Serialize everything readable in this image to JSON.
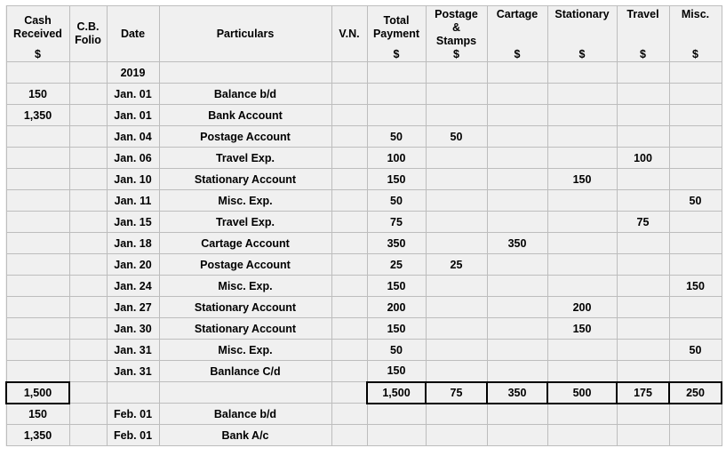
{
  "document": {
    "kind": "petty-cash-book",
    "year_label": "2019",
    "background_color": "#f0f0f0",
    "gridline_color": "#bdbdbd",
    "rule_color": "#000000"
  },
  "columns": [
    {
      "key": "cash",
      "lines": [
        "Cash",
        "Received"
      ],
      "unit": "$",
      "align": "middle"
    },
    {
      "key": "folio",
      "lines": [
        "C.B.",
        "Folio"
      ],
      "unit": "",
      "align": "middle"
    },
    {
      "key": "date",
      "lines": [
        "Date"
      ],
      "unit": "",
      "align": "middle"
    },
    {
      "key": "part",
      "lines": [
        "Particulars"
      ],
      "unit": "",
      "align": "middle"
    },
    {
      "key": "vn",
      "lines": [
        "V.N."
      ],
      "unit": "",
      "align": "middle"
    },
    {
      "key": "total",
      "lines": [
        "Total",
        "Payment"
      ],
      "unit": "$",
      "align": "middle"
    },
    {
      "key": "postage",
      "lines": [
        "Postage",
        "&",
        "Stamps"
      ],
      "unit": "$",
      "align": "top"
    },
    {
      "key": "cartage",
      "lines": [
        "Cartage"
      ],
      "unit": "$",
      "align": "top"
    },
    {
      "key": "stat",
      "lines": [
        "Stationary"
      ],
      "unit": "$",
      "align": "top"
    },
    {
      "key": "travel",
      "lines": [
        "Travel"
      ],
      "unit": "$",
      "align": "top"
    },
    {
      "key": "misc",
      "lines": [
        "Misc."
      ],
      "unit": "$",
      "align": "top"
    }
  ],
  "header": {
    "cash_l1": "Cash",
    "cash_l2": "Received",
    "cash_unit": "$",
    "folio_l1": "C.B.",
    "folio_l2": "Folio",
    "date_l1": "Date",
    "part_l1": "Particulars",
    "vn_l1": "V.N.",
    "total_l1": "Total",
    "total_l2": "Payment",
    "total_unit": "$",
    "postage_l1": "Postage",
    "postage_l2": "&",
    "postage_l3": "Stamps",
    "postage_unit": "$",
    "cartage_l1": "Cartage",
    "cartage_unit": "$",
    "stat_l1": "Stationary",
    "stat_unit": "$",
    "travel_l1": "Travel",
    "travel_unit": "$",
    "misc_l1": "Misc.",
    "misc_unit": "$"
  },
  "rows": [
    {
      "cash": "",
      "folio": "",
      "date": "",
      "part": "",
      "vn": "",
      "total": "",
      "postage": "",
      "cartage": "",
      "stat": "",
      "travel": "",
      "misc": "",
      "year_cell": "2019"
    },
    {
      "cash": "150",
      "folio": "",
      "date": "Jan. 01",
      "part": "Balance b/d",
      "vn": "",
      "total": "",
      "postage": "",
      "cartage": "",
      "stat": "",
      "travel": "",
      "misc": ""
    },
    {
      "cash": "1,350",
      "folio": "",
      "date": "Jan. 01",
      "part": "Bank Account",
      "vn": "",
      "total": "",
      "postage": "",
      "cartage": "",
      "stat": "",
      "travel": "",
      "misc": ""
    },
    {
      "cash": "",
      "folio": "",
      "date": "Jan. 04",
      "part": "Postage Account",
      "vn": "",
      "total": "50",
      "postage": "50",
      "cartage": "",
      "stat": "",
      "travel": "",
      "misc": ""
    },
    {
      "cash": "",
      "folio": "",
      "date": "Jan. 06",
      "part": "Travel Exp.",
      "vn": "",
      "total": "100",
      "postage": "",
      "cartage": "",
      "stat": "",
      "travel": "100",
      "misc": ""
    },
    {
      "cash": "",
      "folio": "",
      "date": "Jan. 10",
      "part": "Stationary Account",
      "vn": "",
      "total": "150",
      "postage": "",
      "cartage": "",
      "stat": "150",
      "travel": "",
      "misc": ""
    },
    {
      "cash": "",
      "folio": "",
      "date": "Jan. 11",
      "part": "Misc. Exp.",
      "vn": "",
      "total": "50",
      "postage": "",
      "cartage": "",
      "stat": "",
      "travel": "",
      "misc": "50"
    },
    {
      "cash": "",
      "folio": "",
      "date": "Jan. 15",
      "part": "Travel Exp.",
      "vn": "",
      "total": "75",
      "postage": "",
      "cartage": "",
      "stat": "",
      "travel": "75",
      "misc": ""
    },
    {
      "cash": "",
      "folio": "",
      "date": "Jan. 18",
      "part": "Cartage Account",
      "vn": "",
      "total": "350",
      "postage": "",
      "cartage": "350",
      "stat": "",
      "travel": "",
      "misc": ""
    },
    {
      "cash": "",
      "folio": "",
      "date": "Jan. 20",
      "part": "Postage Account",
      "vn": "",
      "total": "25",
      "postage": "25",
      "cartage": "",
      "stat": "",
      "travel": "",
      "misc": ""
    },
    {
      "cash": "",
      "folio": "",
      "date": "Jan. 24",
      "part": "Misc. Exp.",
      "vn": "",
      "total": "150",
      "postage": "",
      "cartage": "",
      "stat": "",
      "travel": "",
      "misc": "150"
    },
    {
      "cash": "",
      "folio": "",
      "date": "Jan. 27",
      "part": "Stationary Account",
      "vn": "",
      "total": "200",
      "postage": "",
      "cartage": "",
      "stat": "200",
      "travel": "",
      "misc": ""
    },
    {
      "cash": "",
      "folio": "",
      "date": "Jan. 30",
      "part": "Stationary Account",
      "vn": "",
      "total": "150",
      "postage": "",
      "cartage": "",
      "stat": "150",
      "travel": "",
      "misc": ""
    },
    {
      "cash": "",
      "folio": "",
      "date": "Jan. 31",
      "part": "Misc. Exp.",
      "vn": "",
      "total": "50",
      "postage": "",
      "cartage": "",
      "stat": "",
      "travel": "",
      "misc": "50"
    },
    {
      "cash": "",
      "folio": "",
      "date": "Jan. 31",
      "part": "Banlance C/d",
      "vn": "",
      "total": "150",
      "postage": "",
      "cartage": "",
      "stat": "",
      "travel": "",
      "misc": ""
    },
    {
      "cash": "1,500",
      "folio": "",
      "date": "",
      "part": "",
      "vn": "",
      "total": "1,500",
      "postage": "75",
      "cartage": "350",
      "stat": "500",
      "travel": "175",
      "misc": "250",
      "is_total": true
    },
    {
      "cash": "150",
      "folio": "",
      "date": "Feb. 01",
      "part": "Balance b/d",
      "vn": "",
      "total": "",
      "postage": "",
      "cartage": "",
      "stat": "",
      "travel": "",
      "misc": ""
    },
    {
      "cash": "1,350",
      "folio": "",
      "date": "Feb. 01",
      "part": "Bank A/c",
      "vn": "",
      "total": "",
      "postage": "",
      "cartage": "",
      "stat": "",
      "travel": "",
      "misc": ""
    }
  ]
}
